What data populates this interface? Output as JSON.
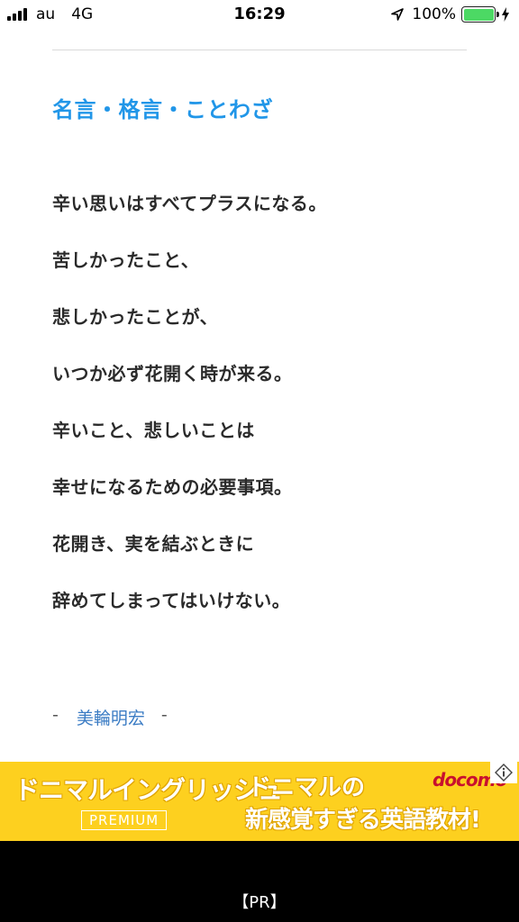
{
  "status_bar": {
    "carrier": "au",
    "network": "4G",
    "time": "16:29",
    "battery_percent": "100%",
    "battery_color": "#4cd964",
    "icons": [
      "signal-icon",
      "location-icon",
      "battery-icon",
      "charging-bolt-icon"
    ]
  },
  "article": {
    "category_link": "名言・格言・ことわざ",
    "category_color": "#2196e8",
    "quote_lines": [
      "辛い思いはすべてプラスになる。",
      "苦しかったこと、",
      "悲しかったことが、",
      "いつか必ず花開く時が来る。",
      "辛いこと、悲しいことは",
      "幸せになるための必要事項。",
      "花開き、実を結ぶときに",
      "辞めてしまってはいけない。"
    ],
    "attribution": {
      "prefix": "-",
      "author": "美輪明宏",
      "suffix": "-"
    }
  },
  "ad": {
    "brand": "ドニマルイングリッシュ",
    "badge": "PREMIUM",
    "headline_1": "ドニマルの",
    "headline_2": "新感覚すぎる英語教材!",
    "logo": "docomo",
    "background_color": "#fdd01f",
    "adchoices_icon": "info-icon",
    "pr_label": "【PR】"
  }
}
